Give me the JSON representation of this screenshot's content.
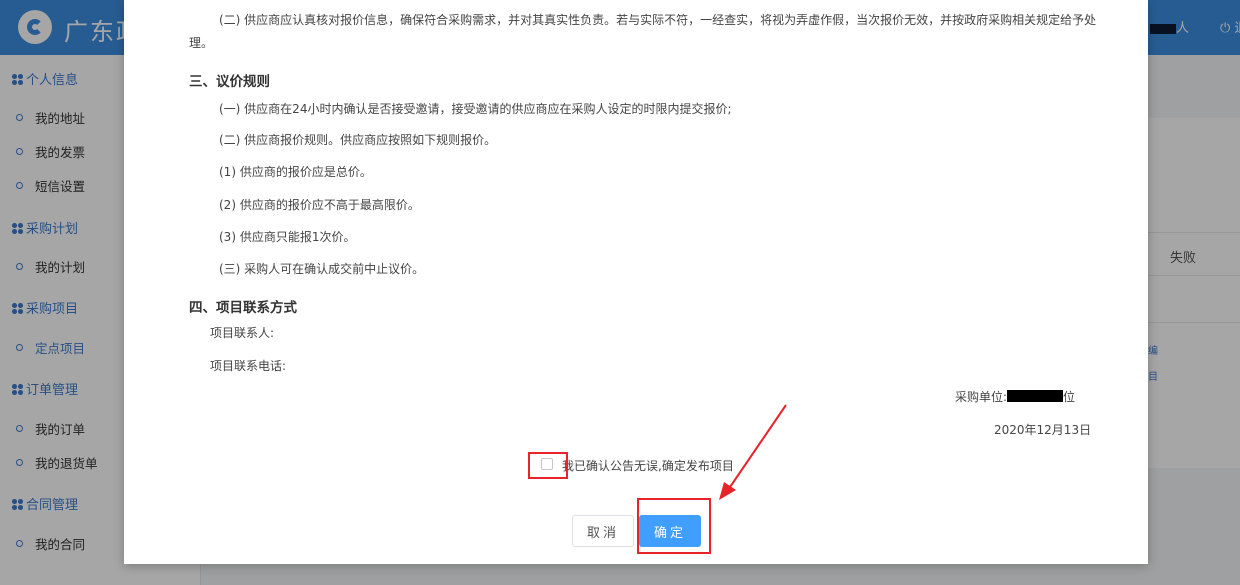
{
  "header": {
    "brand": "广东政",
    "user_suffix": "人",
    "logout_glyph": "⏻ 退"
  },
  "sidebar": {
    "groups": [
      {
        "label": "个人信息"
      },
      {
        "label": "采购计划"
      },
      {
        "label": "采购项目"
      },
      {
        "label": "订单管理"
      },
      {
        "label": "合同管理"
      }
    ],
    "items": [
      {
        "label": "我的地址"
      },
      {
        "label": "我的发票"
      },
      {
        "label": "短信设置"
      },
      {
        "label": "我的计划"
      },
      {
        "label": "定点项目"
      },
      {
        "label": "我的订单"
      },
      {
        "label": "我的退货单"
      },
      {
        "label": "我的合同"
      }
    ]
  },
  "main": {
    "column_fail": "失败",
    "link1": "编",
    "link2": "目"
  },
  "modal": {
    "para_top_line1": "(二) 供应商应认真核对报价信息，确保符合采购需求，并对其真实性负责。若与实际不符，一经查实，将视为弄虚作假，当次报价无效，并按政府采购相关规定给予处",
    "para_top_line2": "理。",
    "section3_title": "三、议价规则",
    "s3_p1": "(一) 供应商在24小时内确认是否接受邀请，接受邀请的供应商应在采购人设定的时限内提交报价;",
    "s3_p2": "(二) 供应商报价规则。供应商应按照如下规则报价。",
    "s3_p3": "(1) 供应商的报价应是总价。",
    "s3_p4": "(2) 供应商的报价应不高于最高限价。",
    "s3_p5": "(3) 供应商只能报1次价。",
    "s3_p6": "(三) 采购人可在确认成交前中止议价。",
    "section4_title": "四、项目联系方式",
    "contact_person": "项目联系人:",
    "contact_phone": "项目联系电话:",
    "purchaser_label": "采购单位:",
    "purchaser_suffix": "位",
    "date": "2020年12月13日",
    "confirm_checkbox_label": "我已确认公告无误,确定发布项目",
    "cancel_label": "取消",
    "ok_label": "确定"
  },
  "colors": {
    "primary": "#409eff",
    "header": "#3d8ee0",
    "annotation": "#e8242a"
  }
}
